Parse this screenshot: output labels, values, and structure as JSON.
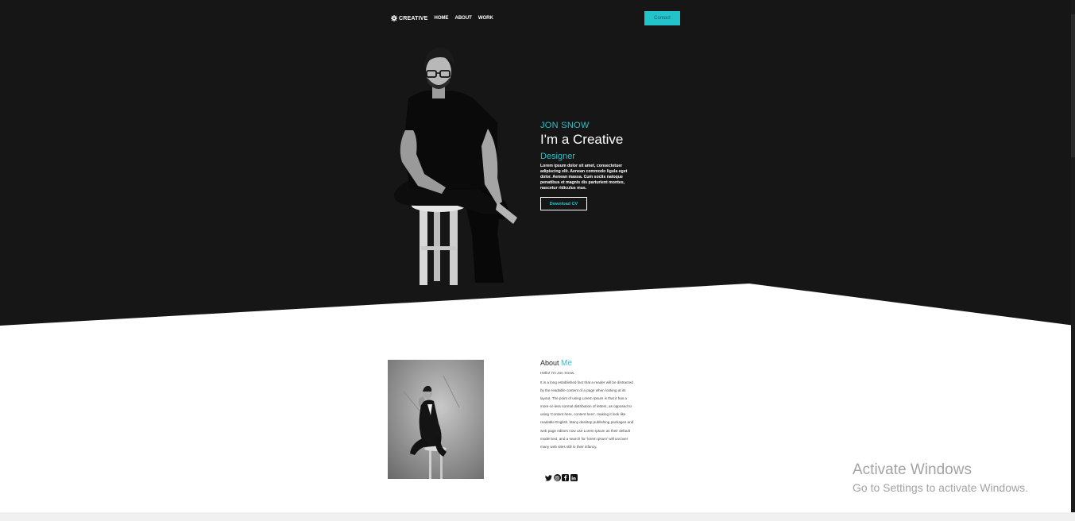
{
  "colors": {
    "accent": "#22c3cb",
    "hero_bg": "#161616",
    "page_bg": "#ffffff"
  },
  "nav": {
    "logo_icon": "gear-icon",
    "logo_text": "CREATIVE",
    "links": [
      "HOME",
      "ABOUT",
      "WORK"
    ],
    "contact_label": "Contact"
  },
  "hero": {
    "name": "JON SNOW",
    "title": "I'm a Creative",
    "role": "Designer",
    "description": "Lorem ipsum dolor sit amet, consectetuer adipiscing elit. Aenean commodo ligula eget dolor. Aenean massa. Cum sociis natoque penatibus et magnis dis parturient montes, nascetur ridiculus mus.",
    "download_label": "Download CV"
  },
  "about": {
    "heading_prefix": "About",
    "heading_accent": "Me",
    "greeting": "Hello! I'm Jon Snow.",
    "body": "It is a long established fact that a reader will be distracted by the readable content of a page when looking at its layout. The point of using Lorem Ipsum is that it has a more-or-less normal distribution of letters, as opposed to using 'Content here, content here', making it look like readable English. Many desktop publishing packages and web page editors now use Lorem Ipsum as their default model text, and a search for 'lorem ipsum' will uncover many web sites still in their infancy.",
    "socials": [
      "twitter-icon",
      "instagram-icon",
      "facebook-icon",
      "linkedin-icon"
    ]
  },
  "watermark": {
    "title": "Activate Windows",
    "subtitle": "Go to Settings to activate Windows."
  }
}
